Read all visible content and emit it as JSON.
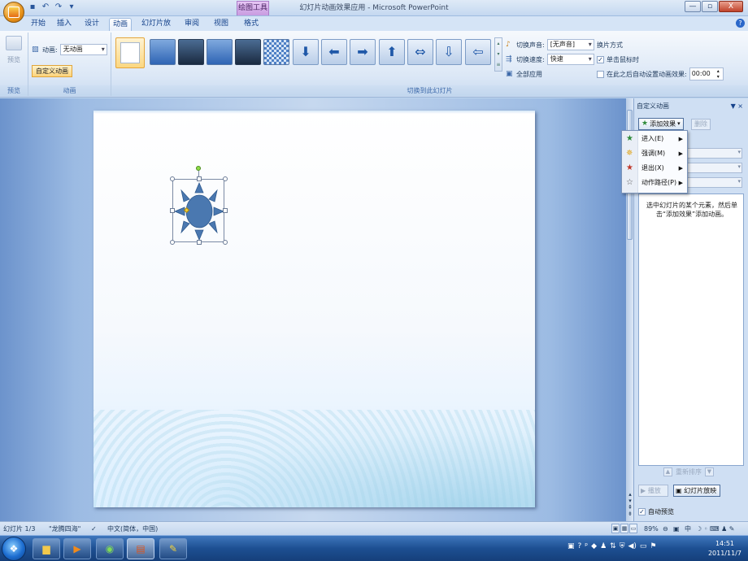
{
  "window": {
    "title": "幻灯片动画效果应用 - Microsoft PowerPoint",
    "context_tab": "绘图工具",
    "controls": {
      "minimize": "—",
      "maximize": "▫",
      "close": "X"
    }
  },
  "qat": {
    "save": "▪",
    "undo": "↶",
    "redo": "↷",
    "customize": "▾"
  },
  "ribbon_tabs": [
    {
      "label": "开始"
    },
    {
      "label": "插入"
    },
    {
      "label": "设计"
    },
    {
      "label": "动画",
      "active": true
    },
    {
      "label": "幻灯片放映"
    },
    {
      "label": "审阅"
    },
    {
      "label": "视图"
    },
    {
      "label": "格式"
    }
  ],
  "ribbon": {
    "preview": {
      "label": "预览",
      "group": "预览"
    },
    "animation_group": {
      "label": "动画",
      "animate_label": "动画:",
      "animate_value": "无动画",
      "custom_button": "自定义动画"
    },
    "transition_group": {
      "label": "切换到此幻灯片",
      "sound_label": "切换声音:",
      "sound_value": "[无声音]",
      "speed_label": "切换速度:",
      "speed_value": "快速",
      "apply_all": "全部应用"
    },
    "switch_mode": {
      "title": "换片方式",
      "on_click": "单击鼠标时",
      "on_click_checked": true,
      "auto_after": "在此之后自动设置动画效果:",
      "auto_checked": false,
      "time_value": "00:00"
    }
  },
  "task_pane": {
    "title": "自定义动画",
    "close": "▼ ×",
    "add_effect": "添加效果",
    "delete": "删除",
    "hint": "选中幻灯片的某个元素，然后单击“添加效果”添加动画。",
    "reorder": "重新排序",
    "play": "播放",
    "slideshow": "幻灯片放映",
    "auto_preview": "自动预览",
    "auto_preview_checked": true
  },
  "menu": [
    {
      "label": "进入(E)",
      "icon": "★",
      "color": "#2e8b3a"
    },
    {
      "label": "强调(M)",
      "icon": "✵",
      "color": "#e0a419"
    },
    {
      "label": "退出(X)",
      "icon": "★",
      "color": "#c0392b"
    },
    {
      "label": "动作路径(P)",
      "icon": "☆",
      "color": "#555555"
    }
  ],
  "statusbar": {
    "slide": "幻灯片 1/3",
    "theme": "\"龙腾四海\"",
    "language": "中文(简体，中国)",
    "zoom": "89%",
    "ime": "中"
  },
  "taskbar": {
    "time": "14:51",
    "date": "2011/11/7"
  },
  "colors": {
    "accent": "#15428b",
    "sun_fill": "#4a78b0",
    "selection": "#e5a63a"
  }
}
